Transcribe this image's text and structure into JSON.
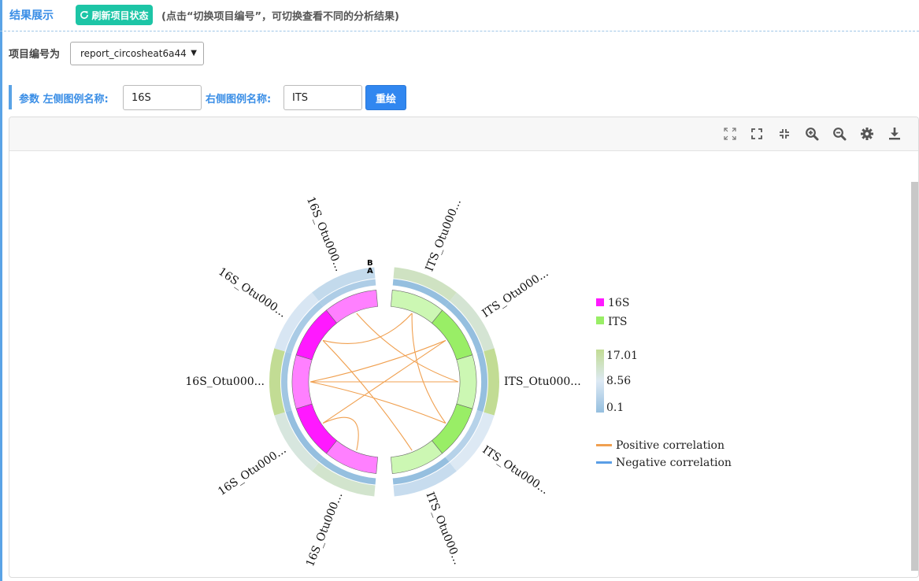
{
  "header": {
    "title": "结果展示",
    "refresh_label": "刷新项目状态",
    "hint": "(点击“切换项目编号”，可切换查看不同的分析结果)"
  },
  "project": {
    "label": "项目编号为",
    "selected": "report_circosheat6a44"
  },
  "params": {
    "prefix": "参数",
    "left_label": "左侧图例名称:",
    "left_value": "16S",
    "right_label": "右侧图例名称:",
    "right_value": "ITS",
    "redraw_label": "重绘"
  },
  "toolbar_icons": [
    "expand-arrows-icon",
    "fullscreen-icon",
    "compress-icon",
    "zoom-in-icon",
    "zoom-out-icon",
    "gear-icon",
    "download-icon"
  ],
  "colors": {
    "accent": "#3a8ee6",
    "refresh_btn": "#1dc5a6",
    "redraw_btn": "#3187f0",
    "group_16S_dark": "#ff19ff",
    "group_16S_light": "#ff80ff",
    "group_ITS_dark": "#99ee66",
    "group_ITS_light": "#ccf7b3",
    "heat_low": "#95bfdf",
    "heat_mid": "#dde9f4",
    "heat_high": "#c2dc94",
    "positive": "#f0a050",
    "negative": "#5a9ee6"
  },
  "chart_data": {
    "type": "circos",
    "track_markers": [
      "B",
      "A"
    ],
    "groups": [
      {
        "name": "16S",
        "color": "#ff19ff"
      },
      {
        "name": "ITS",
        "color": "#99ee66"
      }
    ],
    "segments": [
      {
        "id": "its1",
        "label": "ITS_Otu000...",
        "group": "ITS",
        "shade": "light",
        "heatA": 0.1,
        "heatB": 13.0
      },
      {
        "id": "its2",
        "label": "ITS_Otu000...",
        "group": "ITS",
        "shade": "dark",
        "heatA": 0.1,
        "heatB": 11.5
      },
      {
        "id": "its3",
        "label": "ITS_Otu000...",
        "group": "ITS",
        "shade": "light",
        "heatA": 0.1,
        "heatB": 17.01
      },
      {
        "id": "its4",
        "label": "ITS_Otu000...",
        "group": "ITS",
        "shade": "dark",
        "heatA": 4.0,
        "heatB": 8.56
      },
      {
        "id": "its5",
        "label": "ITS_Otu000...",
        "group": "ITS",
        "shade": "light",
        "heatA": 0.1,
        "heatB": 6.0
      },
      {
        "id": "s1",
        "label": "16S_Otu000...",
        "group": "16S",
        "shade": "light",
        "heatA": 0.1,
        "heatB": 12.0
      },
      {
        "id": "s2",
        "label": "16S_Otu000...",
        "group": "16S",
        "shade": "dark",
        "heatA": 0.1,
        "heatB": 10.5
      },
      {
        "id": "s3",
        "label": "16S_Otu000...",
        "group": "16S",
        "shade": "light",
        "heatA": 1.5,
        "heatB": 17.01
      },
      {
        "id": "s4",
        "label": "16S_Otu000...",
        "group": "16S",
        "shade": "dark",
        "heatA": 2.5,
        "heatB": 8.0
      },
      {
        "id": "s5",
        "label": "16S_Otu000...",
        "group": "16S",
        "shade": "light",
        "heatA": 3.0,
        "heatB": 5.5
      }
    ],
    "links": [
      {
        "from": "its1",
        "to": "its4",
        "type": "positive"
      },
      {
        "from": "its1",
        "to": "s4",
        "type": "positive"
      },
      {
        "from": "its2",
        "to": "s2",
        "type": "positive"
      },
      {
        "from": "its2",
        "to": "s3",
        "type": "positive"
      },
      {
        "from": "its3",
        "to": "s3",
        "type": "positive"
      },
      {
        "from": "its3",
        "to": "s5",
        "type": "positive"
      },
      {
        "from": "its5",
        "to": "s4",
        "type": "positive"
      },
      {
        "from": "s1",
        "to": "s2",
        "type": "positive"
      },
      {
        "from": "s3",
        "to": "its4",
        "type": "positive"
      }
    ],
    "colorbar": {
      "min": 0.1,
      "mid": 8.56,
      "max": 17.01,
      "labels": [
        "17.01",
        "8.56",
        "0.1"
      ]
    },
    "legend": {
      "groups": [
        "16S",
        "ITS"
      ],
      "correlations": [
        {
          "name": "Positive correlation",
          "color": "#f0a050"
        },
        {
          "name": "Negative correlation",
          "color": "#5a9ee6"
        }
      ]
    }
  }
}
